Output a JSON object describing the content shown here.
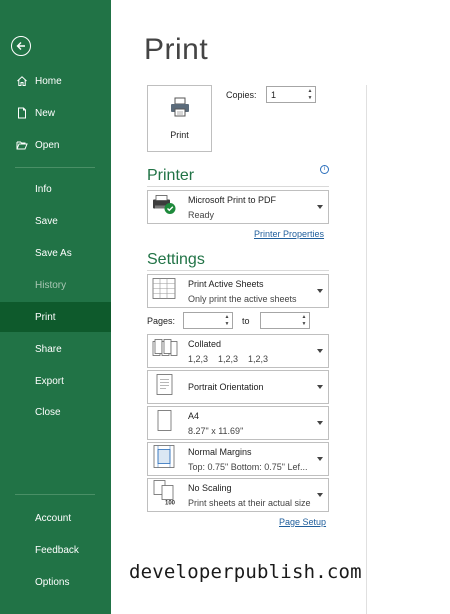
{
  "sidebar": {
    "items": [
      {
        "label": "Home",
        "icon": "home-icon"
      },
      {
        "label": "New",
        "icon": "new-document-icon"
      },
      {
        "label": "Open",
        "icon": "open-folder-icon"
      },
      {
        "label": "Info"
      },
      {
        "label": "Save"
      },
      {
        "label": "Save As"
      },
      {
        "label": "History",
        "disabled": true
      },
      {
        "label": "Print",
        "active": true
      },
      {
        "label": "Share"
      },
      {
        "label": "Export"
      },
      {
        "label": "Close"
      },
      {
        "label": "Account"
      },
      {
        "label": "Feedback"
      },
      {
        "label": "Options"
      }
    ],
    "color": "#217346",
    "active_color": "#0e5a2c"
  },
  "page_title": "Print",
  "print_button": {
    "label": "Print",
    "icon": "printer-icon"
  },
  "copies": {
    "label": "Copies:",
    "value": "1"
  },
  "printer": {
    "heading": "Printer",
    "name": "Microsoft Print to PDF",
    "status": "Ready",
    "properties_link": "Printer Properties"
  },
  "settings": {
    "heading": "Settings",
    "sheets": {
      "title": "Print Active Sheets",
      "subtitle": "Only print the active sheets"
    },
    "pages": {
      "label": "Pages:",
      "to_label": "to",
      "from_value": "",
      "to_value": ""
    },
    "collation": {
      "title": "Collated",
      "subtitle": "1,2,3    1,2,3    1,2,3"
    },
    "orientation": {
      "title": "Portrait Orientation"
    },
    "paper": {
      "title": "A4",
      "subtitle": "8.27\" x 11.69\""
    },
    "margins": {
      "title": "Normal Margins",
      "subtitle": "Top: 0.75\" Bottom: 0.75\" Lef..."
    },
    "scaling": {
      "title": "No Scaling",
      "subtitle": "Print sheets at their actual size"
    },
    "page_setup_link": "Page Setup"
  },
  "watermark": "developerpublish.com"
}
